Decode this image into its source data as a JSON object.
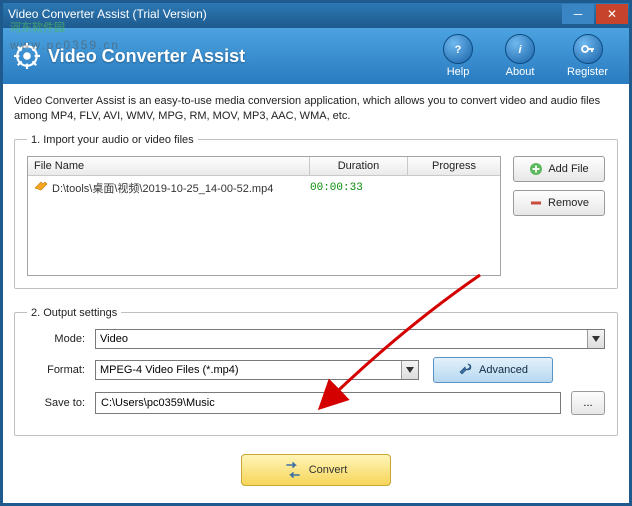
{
  "titlebar": {
    "text": "Video Converter Assist (Trial Version)"
  },
  "header": {
    "app_title": "Video Converter Assist",
    "icons": {
      "help": "Help",
      "about": "About",
      "register": "Register"
    }
  },
  "description": "Video Converter Assist is an easy-to-use media conversion application, which allows you to convert video and audio files among MP4, FLV, AVI, WMV, MPG, RM, MOV, MP3, AAC, WMA, etc.",
  "import": {
    "legend": "1. Import your audio or video files",
    "columns": {
      "name": "File Name",
      "duration": "Duration",
      "progress": "Progress"
    },
    "row": {
      "name": "D:\\tools\\桌面\\视频\\2019-10-25_14-00-52.mp4",
      "duration": "00:00:33"
    },
    "add_label": "Add File",
    "remove_label": "Remove"
  },
  "output": {
    "legend": "2. Output settings",
    "mode_label": "Mode:",
    "mode_value": "Video",
    "format_label": "Format:",
    "format_value": "MPEG-4 Video Files (*.mp4)",
    "saveto_label": "Save to:",
    "saveto_value": "C:\\Users\\pc0359\\Music",
    "advanced_label": "Advanced",
    "browse_label": "..."
  },
  "convert_label": "Convert",
  "watermark": {
    "main": "河东软件园",
    "sub": "www.pc0359.cn"
  }
}
